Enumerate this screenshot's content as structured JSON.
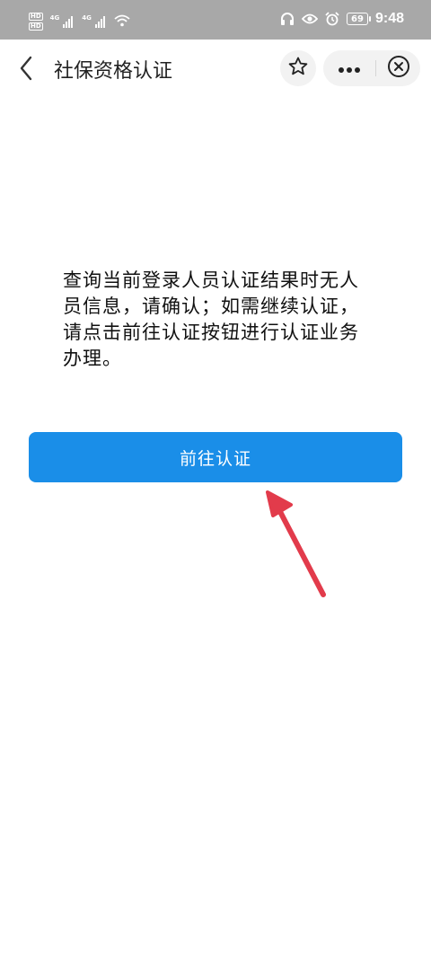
{
  "status_bar": {
    "sim1_badge": "HD",
    "sim2_badge": "HD",
    "sim1_network": "4G",
    "sim2_network": "4G",
    "battery": "69",
    "time": "9:48",
    "icons": [
      "signal-icon",
      "wifi-icon",
      "headphones-icon",
      "eye-icon",
      "alarm-icon",
      "battery-icon"
    ]
  },
  "header": {
    "title": "社保资格认证",
    "icons": [
      "back-chevron-icon",
      "star-icon",
      "more-dots-icon",
      "close-circle-icon"
    ]
  },
  "main": {
    "message": "查询当前登录人员认证结果时无人员信息，请确认；如需继续认证，请点击前往认证按钮进行认证业务办理。",
    "primary_button_label": "前往认证"
  },
  "colors": {
    "status_bar_bg": "#a8a8a8",
    "primary_button": "#1a8ee8",
    "annotation_arrow": "#e23b4b"
  }
}
